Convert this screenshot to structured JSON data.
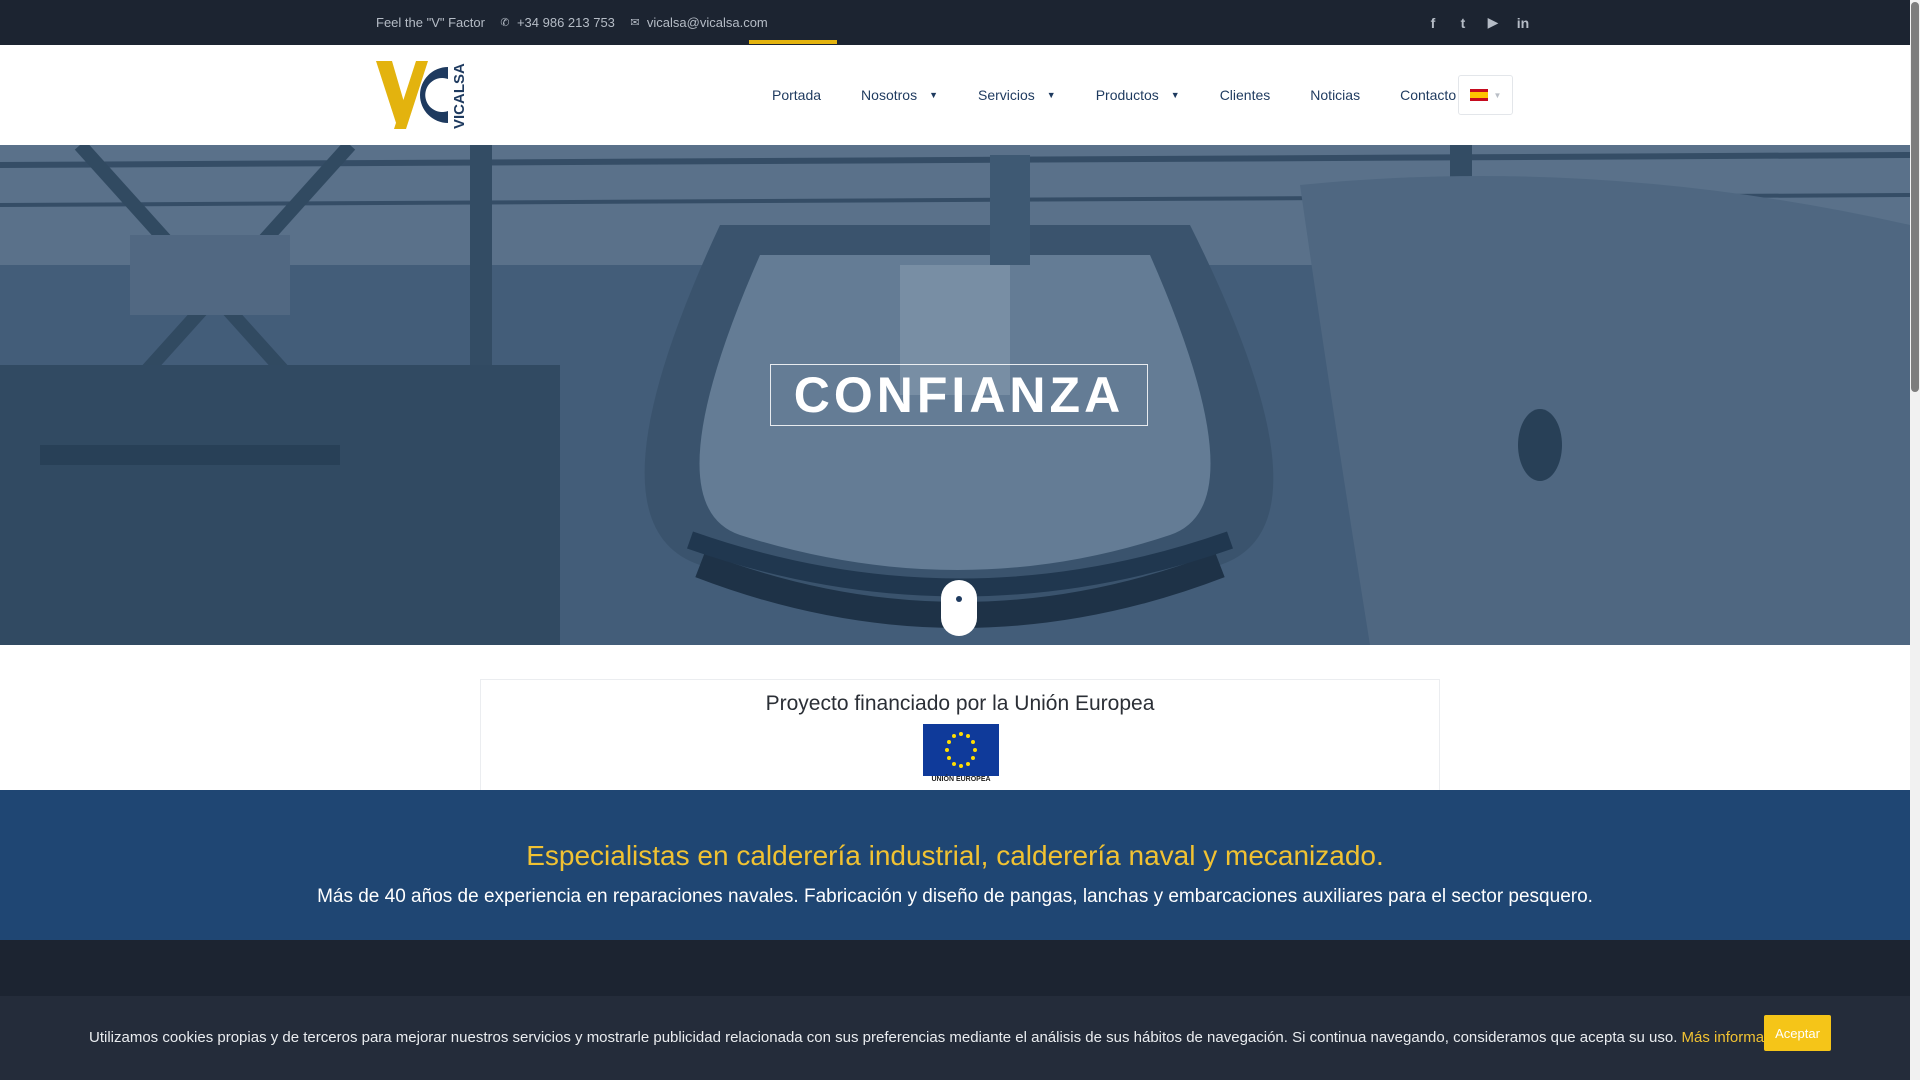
{
  "topbar": {
    "tagline": "Feel the \"V\" Factor",
    "phone": "+34 986 213 753",
    "email": "vicalsa@vicalsa.com",
    "social": [
      {
        "name": "facebook-icon",
        "glyph": "f"
      },
      {
        "name": "twitter-icon",
        "glyph": "t"
      },
      {
        "name": "youtube-icon",
        "glyph": "▶"
      },
      {
        "name": "linkedin-icon",
        "glyph": "in"
      }
    ]
  },
  "header": {
    "logo_text": "VICALSA",
    "nav": [
      {
        "label": "Portada",
        "has_dropdown": false,
        "active": true
      },
      {
        "label": "Nosotros",
        "has_dropdown": true
      },
      {
        "label": "Servicios",
        "has_dropdown": true
      },
      {
        "label": "Productos",
        "has_dropdown": true
      },
      {
        "label": "Clientes",
        "has_dropdown": false
      },
      {
        "label": "Noticias",
        "has_dropdown": false
      },
      {
        "label": "Contacto",
        "has_dropdown": false
      }
    ],
    "language": "es"
  },
  "hero": {
    "title": "CONFIANZA"
  },
  "eu": {
    "title": "Proyecto financiado por la Unión Europea",
    "flag_label": "UNIÓN EUROPEA"
  },
  "banner": {
    "title": "Especialistas en calderería industrial, calderería naval y mecanizado.",
    "subtitle": "Más de 40 años de experiencia en reparaciones navales. Fabricación y diseño de pangas, lanchas y embarcaciones auxiliares para el sector pesquero."
  },
  "cookie": {
    "text": "Utilizamos cookies propias y de terceros para mejorar nuestros servicios y mostrarle publicidad relacionada con sus preferencias mediante el análisis de sus hábitos de navegación. Si continua navegando, consideramos que acepta su uso.",
    "link": "Más información.",
    "accept": "Aceptar"
  },
  "colors": {
    "accent": "#e3b30e",
    "navy": "#1e3a5f",
    "banner": "#1f4673",
    "dark": "#1c2431"
  }
}
